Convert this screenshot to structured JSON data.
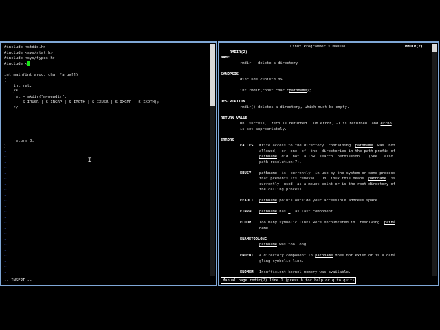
{
  "left_pane": {
    "code_lines": [
      "#include <stdio.h>",
      "#include <sys/stat.h>",
      "#include <sys/types.h>",
      "#include <",
      "",
      "int main(int argc, char *argv[])",
      "{",
      "    int ret;",
      "    /*",
      "    ret = mkdir(\"mynewdir\",",
      "        S_IRUSR | S_IRGRP | S_IROTH | S_IXUSR | S_IXGRP | S_IXOTH);",
      "    */",
      "",
      "",
      "",
      "",
      "",
      "    return 0;",
      "}"
    ],
    "tilde_lines": [
      "~",
      "~",
      "~",
      "~",
      "~",
      "~",
      "~",
      "~",
      "~",
      "~",
      "~",
      "~",
      "~",
      "~",
      "~",
      "~",
      "~",
      "~",
      "~",
      "~",
      "~",
      "~",
      "~",
      "~"
    ],
    "mode_label": "-- INSERT --"
  },
  "right_pane": {
    "header_left": "RMDIR(2)",
    "header_center": "Linux Programmer's Manual",
    "header_right": "RMDIR(2)",
    "name_heading": "NAME",
    "name_text": "rmdir - delete a directory",
    "synopsis_heading": "SYNOPSIS",
    "synopsis_include": "#include <unistd.h>",
    "synopsis_proto_pre": "int rmdir(const char *",
    "synopsis_proto_arg": "pathname",
    "synopsis_proto_post": ");",
    "description_heading": "DESCRIPTION",
    "description_text": "rmdir() deletes a directory, which must be empty.",
    "return_heading": "RETURN VALUE",
    "return_line1_pre": "On  success,  zero is returned.  On error, -1 is returned, and ",
    "return_line1_u": "errno",
    "return_line2": "is set appropriately.",
    "errors_heading": "ERRORS",
    "eacces": {
      "name": "EACCES",
      "l1a": "Write access to the directory  containing  ",
      "l1u": "pathname",
      "l1b": "  was  not",
      "l2": "allowed,  or  one  of  the  directories in the path prefix of",
      "l3u": "pathname",
      "l3b": "  did  not  allow  search  permission.   (See   also",
      "l4": "path_resolution(7)."
    },
    "ebusy": {
      "name": "EBUSY",
      "l1u": "pathname",
      "l1b": "  is  currently  in use by the system or some process",
      "l2a": "that prevents its removal.  On Linux this means  ",
      "l2u": "pathname",
      "l2b": "  is",
      "l3": "currently  used  as a mount point or is the root directory of",
      "l4": "the calling process."
    },
    "efault": {
      "name": "EFAULT",
      "u": "pathname",
      "rest": " points outside your accessible address space."
    },
    "einval": {
      "name": "EINVAL",
      "u": "pathname",
      "mid": " has ",
      "u2": ".",
      "rest": "  as last component."
    },
    "eloop": {
      "name": "ELOOP",
      "l1": "Too many symbolic links were encountered in  resolving  ",
      "l1u": "pathâ",
      "l2u": "name",
      "l2b": "."
    },
    "enametoolong": {
      "name": "ENAMETOOLONG",
      "u": "pathname",
      "rest": " was too long."
    },
    "enoent": {
      "name": "ENOENT",
      "l1a": "A directory component in ",
      "l1u": "pathname",
      "l1b": " does not exist or is a danâ",
      "l2": "gling symbolic link."
    },
    "enomem": {
      "name": "ENOMEM",
      "text": "Insufficient kernel memory was available."
    },
    "status_text": "Manual page rmdir(2) line 1 (press h for help or q to quit)"
  }
}
